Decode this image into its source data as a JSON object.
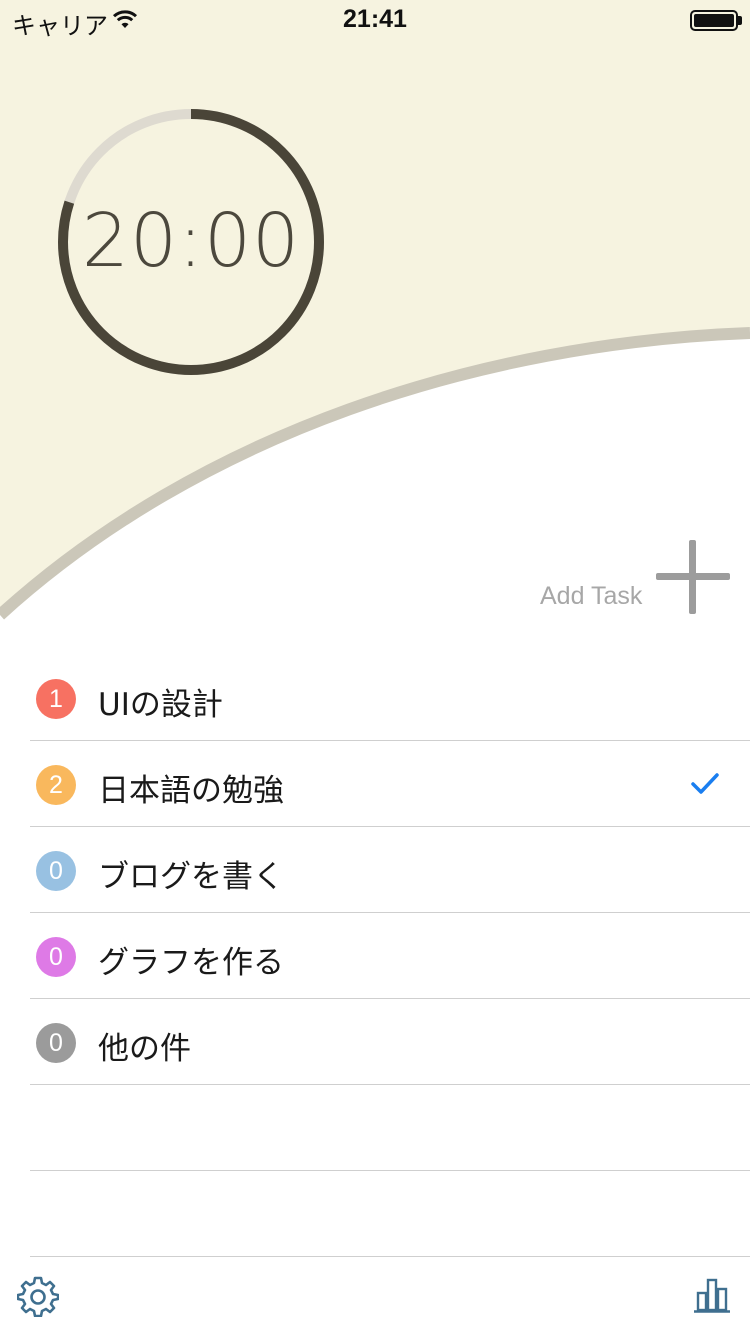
{
  "status_bar": {
    "carrier": "キャリア",
    "time": "21:41"
  },
  "timer": {
    "display": "20:00",
    "progress_remaining": 0.8,
    "colors": {
      "track": "#dedad0",
      "progress": "#4a4538",
      "background": "#f6f3e0"
    }
  },
  "add_task": {
    "label": "Add Task"
  },
  "tasks": [
    {
      "count": "1",
      "name": "UIの設計",
      "color": "#f77162",
      "checked": false
    },
    {
      "count": "2",
      "name": "日本語の勉強",
      "color": "#f9b85d",
      "checked": true
    },
    {
      "count": "0",
      "name": "ブログを書く",
      "color": "#98c1e2",
      "checked": false
    },
    {
      "count": "0",
      "name": "グラフを作る",
      "color": "#de7ae6",
      "checked": false
    },
    {
      "count": "0",
      "name": "他の件",
      "color": "#9b9b9b",
      "checked": false
    }
  ],
  "bottom_bar": {
    "settings_icon": "gear-icon",
    "stats_icon": "bar-chart-icon"
  },
  "accent_color": "#1a7ef0"
}
